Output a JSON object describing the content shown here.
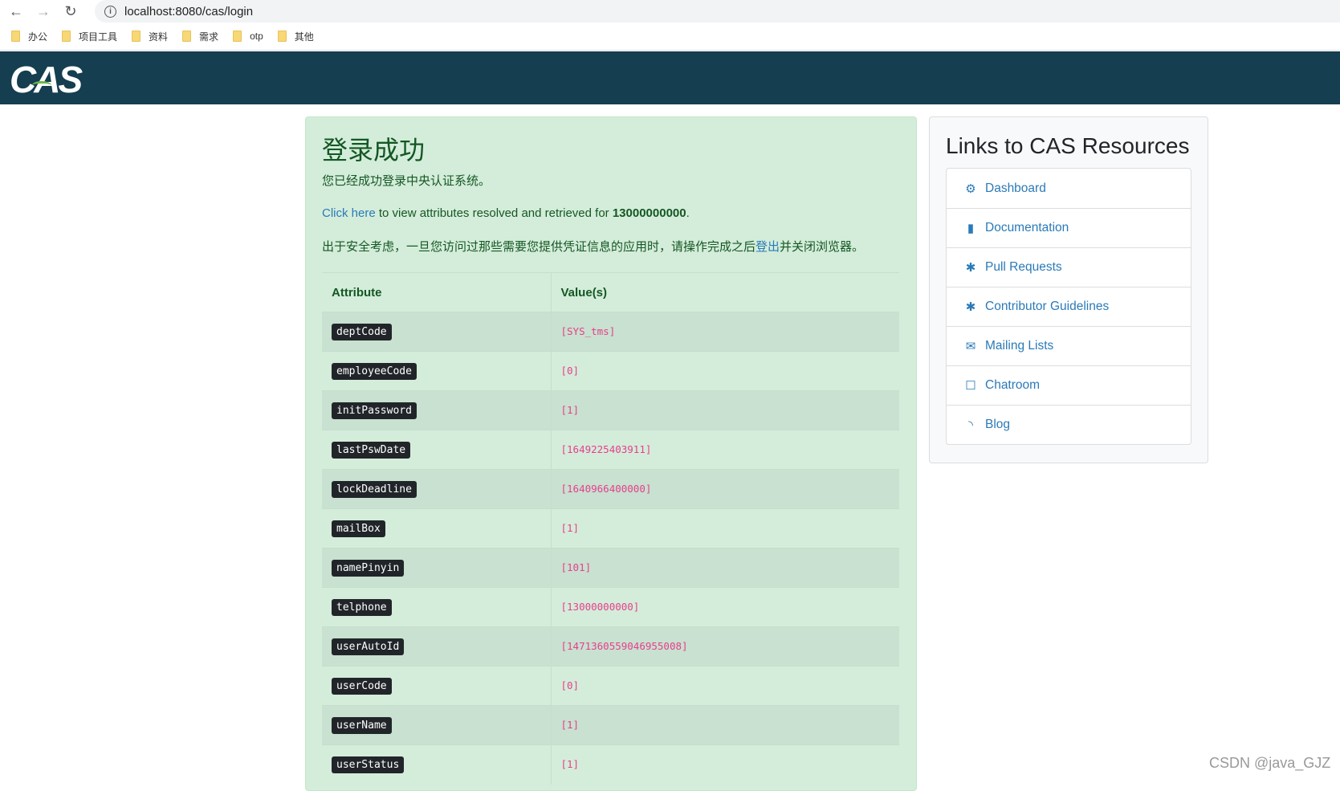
{
  "browser": {
    "url": "localhost:8080/cas/login",
    "bookmarks": [
      "办公",
      "项目工具",
      "资料",
      "需求",
      "otp",
      "其他"
    ]
  },
  "header": {
    "logo": "CAS"
  },
  "main": {
    "title": "登录成功",
    "subtitle": "您已经成功登录中央认证系统。",
    "click_here": "Click here",
    "attr_text": " to view attributes resolved and retrieved for ",
    "user": "13000000000",
    "period": ".",
    "security_pre": "出于安全考虑，一旦您访问过那些需要您提供凭证信息的应用时，请操作完成之后",
    "logout": "登出",
    "security_post": "并关闭浏览器。",
    "table": {
      "headers": [
        "Attribute",
        "Value(s)"
      ],
      "rows": [
        {
          "attr": "deptCode",
          "value": "[SYS_tms]"
        },
        {
          "attr": "employeeCode",
          "value": "[0]"
        },
        {
          "attr": "initPassword",
          "value": "[1]"
        },
        {
          "attr": "lastPswDate",
          "value": "[1649225403911]"
        },
        {
          "attr": "lockDeadline",
          "value": "[1640966400000]"
        },
        {
          "attr": "mailBox",
          "value": "[1]"
        },
        {
          "attr": "namePinyin",
          "value": "[101]"
        },
        {
          "attr": "telphone",
          "value": "[13000000000]"
        },
        {
          "attr": "userAutoId",
          "value": "[1471360559046955008]"
        },
        {
          "attr": "userCode",
          "value": "[0]"
        },
        {
          "attr": "userName",
          "value": "[1]"
        },
        {
          "attr": "userStatus",
          "value": "[1]"
        }
      ]
    }
  },
  "sidebar": {
    "title": "Links to CAS Resources",
    "items": [
      {
        "label": "Dashboard",
        "icon": "cogs-icon",
        "glyph": "⚙"
      },
      {
        "label": "Documentation",
        "icon": "file-icon",
        "glyph": "▮"
      },
      {
        "label": "Pull Requests",
        "icon": "bug-icon",
        "glyph": "✱"
      },
      {
        "label": "Contributor Guidelines",
        "icon": "bug-icon",
        "glyph": "✱"
      },
      {
        "label": "Mailing Lists",
        "icon": "envelope-icon",
        "glyph": "✉"
      },
      {
        "label": "Chatroom",
        "icon": "comment-icon",
        "glyph": "☐"
      },
      {
        "label": "Blog",
        "icon": "rss-icon",
        "glyph": "◝"
      }
    ]
  },
  "watermark": "CSDN @java_GJZ",
  "colors": {
    "header": "#153e50",
    "success_bg": "#d4edda",
    "link": "#2a7ab8",
    "code": "#e83e8c"
  }
}
